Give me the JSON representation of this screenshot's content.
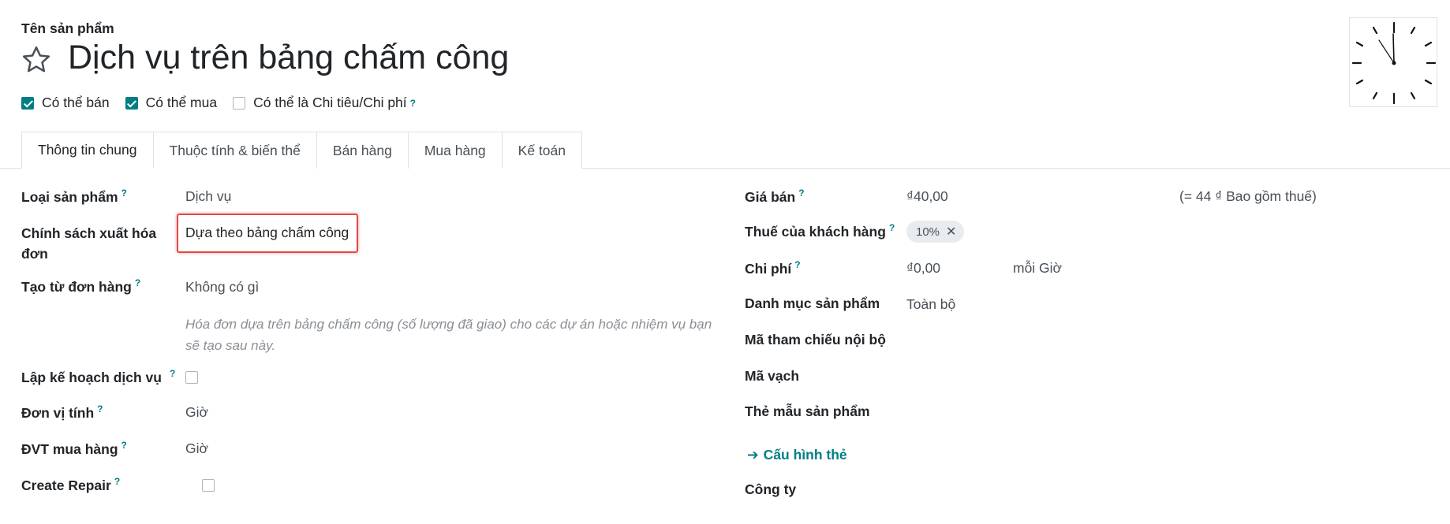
{
  "header": {
    "field_label": "Tên sản phẩm",
    "product_name": "Dịch vụ trên bảng chấm công",
    "checkboxes": [
      {
        "label": "Có thể bán",
        "checked": true
      },
      {
        "label": "Có thể mua",
        "checked": true
      },
      {
        "label": "Có thể là Chi tiêu/Chi phí",
        "checked": false
      }
    ],
    "help_mark": "?"
  },
  "tabs": [
    "Thông tin chung",
    "Thuộc tính & biến thể",
    "Bán hàng",
    "Mua hàng",
    "Kế toán"
  ],
  "left": {
    "product_type": {
      "label": "Loại sản phẩm",
      "value": "Dịch vụ"
    },
    "invoice_policy": {
      "label_line1": "Chính sách xuất hóa",
      "label_line2": "đơn",
      "value": "Dựa theo bảng chấm công"
    },
    "create_from_order": {
      "label": "Tạo từ đơn hàng",
      "value": "Không có gì"
    },
    "note_line1": "Hóa đơn dựa trên bảng chấm công (số lượng đã giao) cho các dự án hoặc nhiệm vụ bạn",
    "note_line2": "sẽ tạo sau này.",
    "plan_services": {
      "label": "Lập kế hoạch dịch vụ",
      "checked": false
    },
    "uom": {
      "label": "Đơn vị tính",
      "value": "Giờ"
    },
    "purchase_uom": {
      "label": "ĐVT mua hàng",
      "value": "Giờ"
    },
    "create_repair": {
      "label": "Create Repair",
      "checked": false
    }
  },
  "right": {
    "sales_price": {
      "label": "Giá bán",
      "value": "₫40,00",
      "tax_incl": "(= 44 ₫ Bao gồm thuế)"
    },
    "customer_taxes": {
      "label": "Thuế của khách hàng",
      "tag": "10%",
      "tag_remove": "✕"
    },
    "cost": {
      "label": "Chi phí",
      "value": "₫0,00",
      "per": "mỗi Giờ"
    },
    "category": {
      "label": "Danh mục sản phẩm",
      "value": "Toàn bộ"
    },
    "internal_ref": {
      "label": "Mã tham chiếu nội bộ"
    },
    "barcode": {
      "label": "Mã vạch"
    },
    "product_tags": {
      "label": "Thẻ mẫu sản phẩm"
    },
    "configure_tags": {
      "arrow": "➔",
      "label": "Cấu hình thẻ"
    },
    "company": {
      "label": "Công ty"
    }
  },
  "colors": {
    "accent": "#017e84",
    "highlight": "#e04848"
  },
  "icons": {
    "favorite": "star-outline-icon",
    "image": "clock-icon"
  }
}
